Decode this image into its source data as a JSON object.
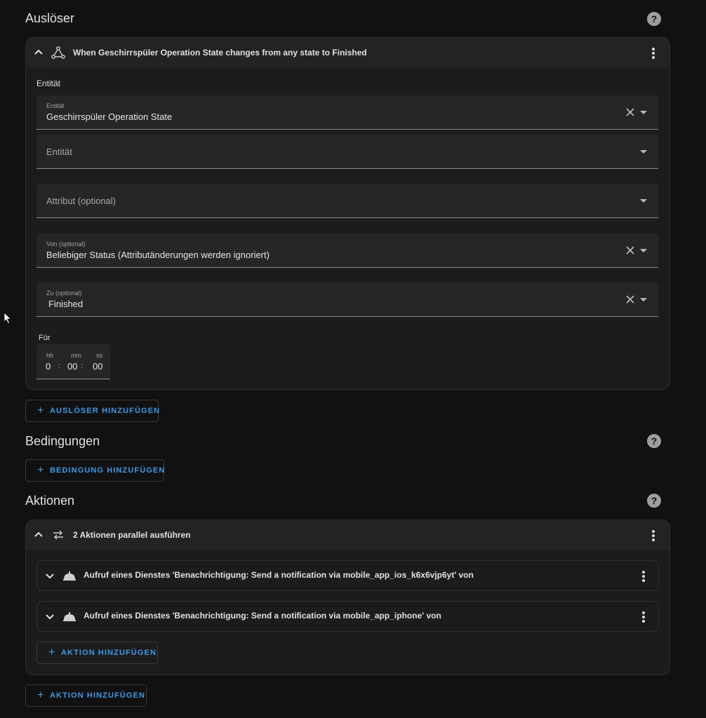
{
  "triggers": {
    "title": "Auslöser",
    "card_title": "When Geschirrspüler Operation State changes from any state to Finished",
    "section_label": "Entität",
    "entity_field": {
      "label": "Entität",
      "value": "Geschirrspüler Operation State"
    },
    "entity_field_2": {
      "label": "Entität"
    },
    "attribute_field": {
      "label": "Attribut (optional)"
    },
    "from_field": {
      "label": "Von (optional)",
      "value": "Beliebiger Status (Attributänderungen werden ignoriert)"
    },
    "to_field": {
      "label": "Zu (optional)",
      "value": "Finished"
    },
    "duration": {
      "label": "Für",
      "hh_label": "hh",
      "mm_label": "mm",
      "ss_label": "ss",
      "hh": "0",
      "mm": "00",
      "ss": "00",
      "sep": ":"
    },
    "add_label": "AUSLÖSER HINZUFÜGEN"
  },
  "conditions": {
    "title": "Bedingungen",
    "add_label": "BEDINGUNG HINZUFÜGEN"
  },
  "actions": {
    "title": "Aktionen",
    "parallel_title": "2 Aktionen parallel ausführen",
    "items": [
      {
        "label": "Aufruf eines Dienstes 'Benachrichtigung: Send a notification via mobile_app_ios_k6x6vjp6yt' von"
      },
      {
        "label": "Aufruf eines Dienstes 'Benachrichtigung: Send a notification via mobile_app_iphone' von"
      }
    ],
    "inner_add_label": "AKTION HINZUFÜGEN",
    "add_label": "AKTION HINZUFÜGEN"
  },
  "help_icon_text": "?",
  "plus": "+",
  "colors": {
    "background": "#111111",
    "card": "#1c1c1c",
    "accent": "#3d9ae8"
  }
}
